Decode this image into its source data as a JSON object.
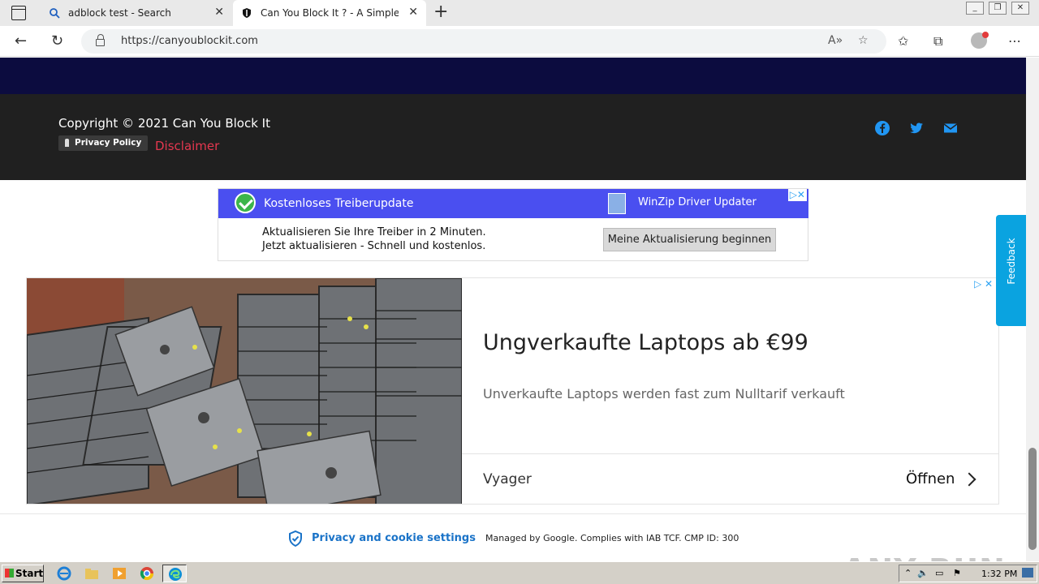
{
  "browser": {
    "tabs": [
      {
        "title": "adblock test - Search"
      },
      {
        "title": "Can You Block It ? - A Simple Ad B"
      }
    ],
    "url": "https://canyoublockit.com"
  },
  "footer": {
    "copyright": "Copyright © 2021 Can You Block It",
    "privacy_policy": "Privacy Policy",
    "disclaimer": "Disclaimer"
  },
  "ad_driver": {
    "headline": "Kostenloses Treiberupdate",
    "brand": "WinZip Driver Updater",
    "line1": "Aktualisieren Sie Ihre Treiber in 2 Minuten.",
    "line2": "Jetzt aktualisieren - Schnell und kostenlos.",
    "cta": "Meine Aktualisierung beginnen"
  },
  "ad_laptops": {
    "headline": "Ungverkaufte Laptops ab €99",
    "description": "Unverkaufte Laptops werden fast zum Nulltarif verkauft",
    "advertiser": "Vyager",
    "cta": "Öffnen"
  },
  "feedback": "Feedback",
  "consent": {
    "link": "Privacy and cookie settings",
    "note": "Managed by Google. Complies with IAB TCF. CMP ID: 300"
  },
  "watermark": "ANY RUN",
  "taskbar": {
    "start": "Start",
    "time": "1:32 PM"
  },
  "colors": {
    "navy": "#0c0c3f",
    "footer_bg": "#202020",
    "disclaimer": "#e5374f",
    "social": "#2196f3",
    "ad_header": "#4a4ff0",
    "feedback": "#0aa3e0"
  }
}
